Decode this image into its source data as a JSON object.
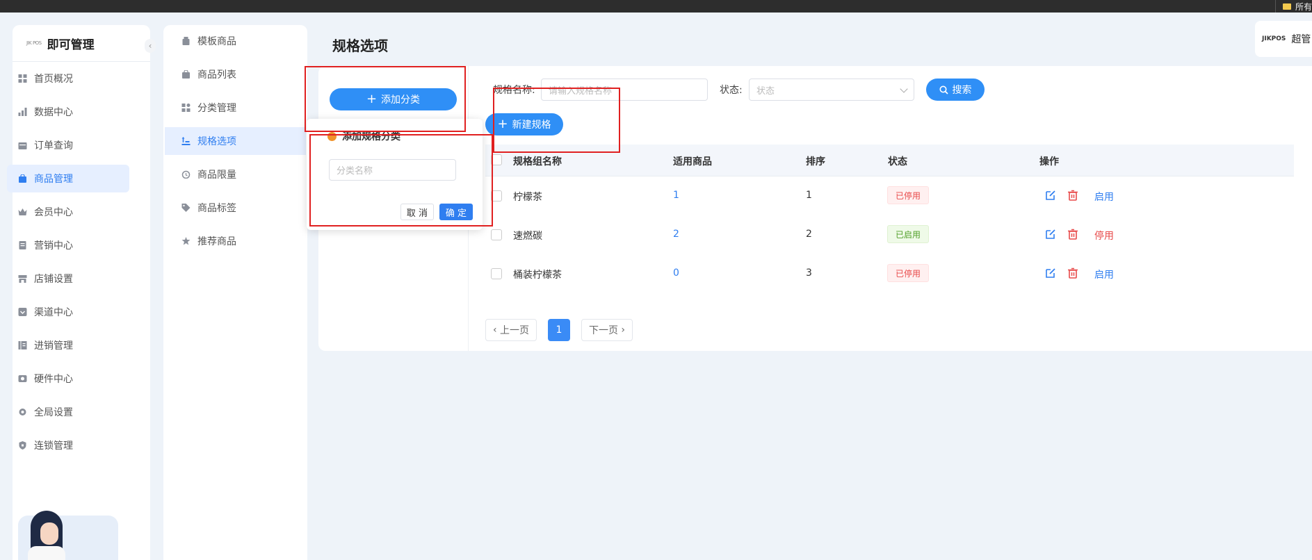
{
  "topbar": {
    "right_text": "所有"
  },
  "brand": {
    "logo_text": "JIKPOS",
    "title": "超管"
  },
  "sidebar": {
    "logo_mark": "JIK POS",
    "app_title": "即可管理",
    "collapse_glyph": "‹",
    "items": [
      {
        "label": "首页概况",
        "icon": "dashboard-icon"
      },
      {
        "label": "数据中心",
        "icon": "bar-chart-icon"
      },
      {
        "label": "订单查询",
        "icon": "calendar-icon"
      },
      {
        "label": "商品管理",
        "icon": "bag-icon"
      },
      {
        "label": "会员中心",
        "icon": "crown-icon"
      },
      {
        "label": "营销中心",
        "icon": "ticket-icon"
      },
      {
        "label": "店铺设置",
        "icon": "store-icon"
      },
      {
        "label": "渠道中心",
        "icon": "channel-icon"
      },
      {
        "label": "进销管理",
        "icon": "inventory-icon"
      },
      {
        "label": "硬件中心",
        "icon": "hardware-icon"
      },
      {
        "label": "全局设置",
        "icon": "gear-icon"
      },
      {
        "label": "连锁管理",
        "icon": "shield-icon"
      }
    ]
  },
  "subnav": {
    "items": [
      {
        "label": "模板商品",
        "icon": "template-icon"
      },
      {
        "label": "商品列表",
        "icon": "list-bag-icon"
      },
      {
        "label": "分类管理",
        "icon": "category-icon"
      },
      {
        "label": "规格选项",
        "icon": "spec-icon"
      },
      {
        "label": "商品限量",
        "icon": "alarm-icon"
      },
      {
        "label": "商品标签",
        "icon": "tag-icon"
      },
      {
        "label": "推荐商品",
        "icon": "star-icon"
      }
    ]
  },
  "page": {
    "title": "规格选项"
  },
  "category_panel": {
    "add_button": "添加分类"
  },
  "popover": {
    "title": "添加规格分类",
    "input_placeholder": "分类名称",
    "cancel": "取 消",
    "confirm": "确 定"
  },
  "filters": {
    "name_label": "规格名称:",
    "name_placeholder": "请输入规格名称",
    "status_label": "状态:",
    "status_placeholder": "状态",
    "search_button": "搜索"
  },
  "new_spec_button": "新建规格",
  "table": {
    "headers": [
      "规格组名称",
      "适用商品",
      "排序",
      "状态",
      "操作"
    ],
    "rows": [
      {
        "name": "柠檬茶",
        "products": "1",
        "sort": "1",
        "status": "已停用",
        "status_type": "off",
        "action": "启用"
      },
      {
        "name": "速燃碳",
        "products": "2",
        "sort": "2",
        "status": "已启用",
        "status_type": "on",
        "action": "停用"
      },
      {
        "name": "桶装柠檬茶",
        "products": "0",
        "sort": "3",
        "status": "已停用",
        "status_type": "off",
        "action": "启用"
      }
    ]
  },
  "pagination": {
    "prev": "上一页",
    "current": "1",
    "next": "下一页"
  },
  "colors": {
    "primary": "#2f7ef0",
    "danger": "#e84a4a",
    "success": "#52a02a",
    "annotation": "#e02020"
  }
}
